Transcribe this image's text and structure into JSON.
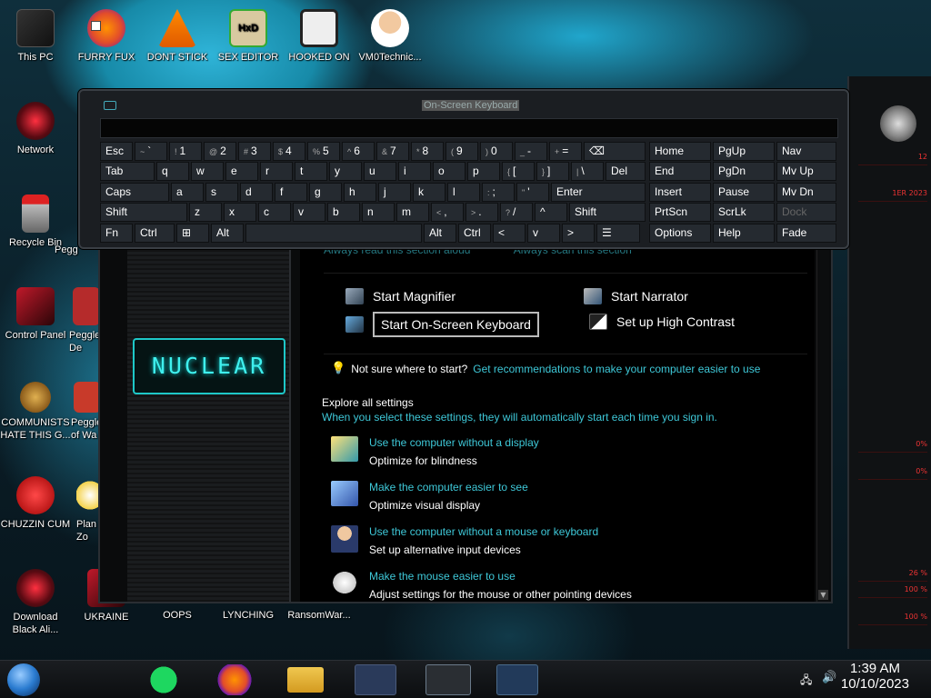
{
  "desktop": {
    "icons": [
      {
        "label": "This PC"
      },
      {
        "label": "FURRY FUX"
      },
      {
        "label": "DONT STICK"
      },
      {
        "label": "SEX EDITOR"
      },
      {
        "label": "HOOKED ON"
      },
      {
        "label": "VM0Technic..."
      },
      {
        "label": "Network"
      },
      {
        "label": "Recycle Bin"
      },
      {
        "label": "Pegg"
      },
      {
        "label": "Control Panel"
      },
      {
        "label": "Peggle De"
      },
      {
        "label": "COMMUNISTS HATE THIS G..."
      },
      {
        "label": "Peggle of Wa"
      },
      {
        "label": "CHUZZIN CUM"
      },
      {
        "label": "Plan Zo"
      },
      {
        "label": "Download Black Ali..."
      },
      {
        "label": "UKRAINE"
      },
      {
        "label": "OOPS"
      },
      {
        "label": "LYNCHING"
      },
      {
        "label": "RansomWar..."
      }
    ]
  },
  "osk": {
    "title": "On-Screen Keyboard",
    "rows": [
      [
        {
          "l": "Esc"
        },
        {
          "s": "~",
          "l": "`"
        },
        {
          "s": "!",
          "l": "1"
        },
        {
          "s": "@",
          "l": "2"
        },
        {
          "s": "#",
          "l": "3"
        },
        {
          "s": "$",
          "l": "4"
        },
        {
          "s": "%",
          "l": "5"
        },
        {
          "s": "^",
          "l": "6"
        },
        {
          "s": "&",
          "l": "7"
        },
        {
          "s": "*",
          "l": "8"
        },
        {
          "s": "(",
          "l": "9"
        },
        {
          "s": ")",
          "l": "0"
        },
        {
          "s": "_",
          "l": "-"
        },
        {
          "s": "+",
          "l": "="
        },
        {
          "l": "⌫"
        },
        {
          "l": "Home"
        },
        {
          "l": "PgUp"
        },
        {
          "l": "Nav"
        }
      ],
      [
        {
          "l": "Tab"
        },
        {
          "l": "q"
        },
        {
          "l": "w"
        },
        {
          "l": "e"
        },
        {
          "l": "r"
        },
        {
          "l": "t"
        },
        {
          "l": "y"
        },
        {
          "l": "u"
        },
        {
          "l": "i"
        },
        {
          "l": "o"
        },
        {
          "l": "p"
        },
        {
          "s": "{",
          "l": "["
        },
        {
          "s": "}",
          "l": "]"
        },
        {
          "s": "|",
          "l": "\\"
        },
        {
          "l": "Del"
        },
        {
          "l": "End"
        },
        {
          "l": "PgDn"
        },
        {
          "l": "Mv Up"
        }
      ],
      [
        {
          "l": "Caps"
        },
        {
          "l": "a"
        },
        {
          "l": "s"
        },
        {
          "l": "d"
        },
        {
          "l": "f"
        },
        {
          "l": "g"
        },
        {
          "l": "h"
        },
        {
          "l": "j"
        },
        {
          "l": "k"
        },
        {
          "l": "l"
        },
        {
          "s": ":",
          "l": ";"
        },
        {
          "s": "\"",
          "l": "'"
        },
        {
          "l": "Enter"
        },
        {
          "l": "Insert"
        },
        {
          "l": "Pause"
        },
        {
          "l": "Mv Dn"
        }
      ],
      [
        {
          "l": "Shift"
        },
        {
          "l": "z"
        },
        {
          "l": "x"
        },
        {
          "l": "c"
        },
        {
          "l": "v"
        },
        {
          "l": "b"
        },
        {
          "l": "n"
        },
        {
          "l": "m"
        },
        {
          "s": "<",
          "l": ","
        },
        {
          "s": ">",
          "l": "."
        },
        {
          "s": "?",
          "l": "/"
        },
        {
          "l": "^"
        },
        {
          "l": "Shift"
        },
        {
          "l": "PrtScn"
        },
        {
          "l": "ScrLk"
        },
        {
          "l": "Dock"
        }
      ],
      [
        {
          "l": "Fn"
        },
        {
          "l": "Ctrl"
        },
        {
          "l": "⊞"
        },
        {
          "l": "Alt"
        },
        {
          "l": ""
        },
        {
          "l": "Alt"
        },
        {
          "l": "Ctrl"
        },
        {
          "l": "<"
        },
        {
          "l": "v"
        },
        {
          "l": ">"
        },
        {
          "l": "☰"
        },
        {
          "l": "Options"
        },
        {
          "l": "Help"
        },
        {
          "l": "Fade"
        }
      ]
    ]
  },
  "cp": {
    "cut_links": [
      "Always read this section aloud",
      "Always scan this section"
    ],
    "logo_text": "NUCLEAR",
    "tools": {
      "magnifier": "Start Magnifier",
      "narrator": "Start Narrator",
      "osk": "Start On-Screen Keyboard",
      "contrast": "Set up High Contrast"
    },
    "hint_prefix": "Not sure where to start?",
    "hint_link": "Get recommendations to make your computer easier to use",
    "explore_title": "Explore all settings",
    "explore_sub": "When you select these settings, they will automatically start each time you sign in.",
    "settings": [
      {
        "link": "Use the computer without a display",
        "desc": "Optimize for blindness"
      },
      {
        "link": "Make the computer easier to see",
        "desc": "Optimize visual display"
      },
      {
        "link": "Use the computer without a mouse or keyboard",
        "desc": "Set up alternative input devices"
      },
      {
        "link": "Make the mouse easier to use",
        "desc": "Adjust settings for the mouse or other pointing devices"
      }
    ]
  },
  "taskbar": {
    "time": "1:39 AM",
    "date": "10/10/2023"
  },
  "hud": {
    "labels": [
      "12",
      "1ER 2023",
      "0%",
      "0%",
      "26 %",
      "100 %",
      "100 %"
    ]
  }
}
